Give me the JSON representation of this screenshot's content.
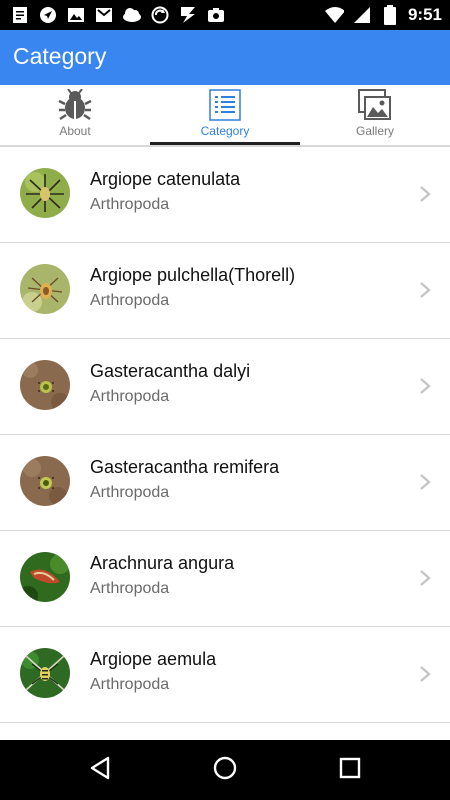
{
  "status_bar": {
    "time": "9:51",
    "left_icons": [
      "notes-icon",
      "navigation-icon",
      "image-icon",
      "mail-icon",
      "cloud-icon",
      "sync-icon",
      "download-icon",
      "camera-icon"
    ],
    "right_icons": [
      "wifi-icon",
      "signal-icon",
      "battery-icon"
    ]
  },
  "app_bar": {
    "title": "Category"
  },
  "tabs": [
    {
      "label": "About",
      "icon": "bug-icon",
      "active": false
    },
    {
      "label": "Category",
      "icon": "list-icon",
      "active": true
    },
    {
      "label": "Gallery",
      "icon": "gallery-icon",
      "active": false
    }
  ],
  "list": {
    "items": [
      {
        "title": "Argiope catenulata",
        "subtitle": "Arthropoda"
      },
      {
        "title": "Argiope pulchella(Thorell)",
        "subtitle": "Arthropoda"
      },
      {
        "title": "Gasteracantha dalyi",
        "subtitle": "Arthropoda"
      },
      {
        "title": "Gasteracantha remifera",
        "subtitle": "Arthropoda"
      },
      {
        "title": "Arachnura angura",
        "subtitle": "Arthropoda"
      },
      {
        "title": "Argiope aemula",
        "subtitle": "Arthropoda"
      }
    ]
  },
  "nav_bar": {
    "icons": [
      "back-icon",
      "home-icon",
      "recents-icon"
    ]
  },
  "colors": {
    "app_bar": "#3a86f0",
    "active_tab": "#2f7fe0",
    "status_bar": "#000000"
  }
}
